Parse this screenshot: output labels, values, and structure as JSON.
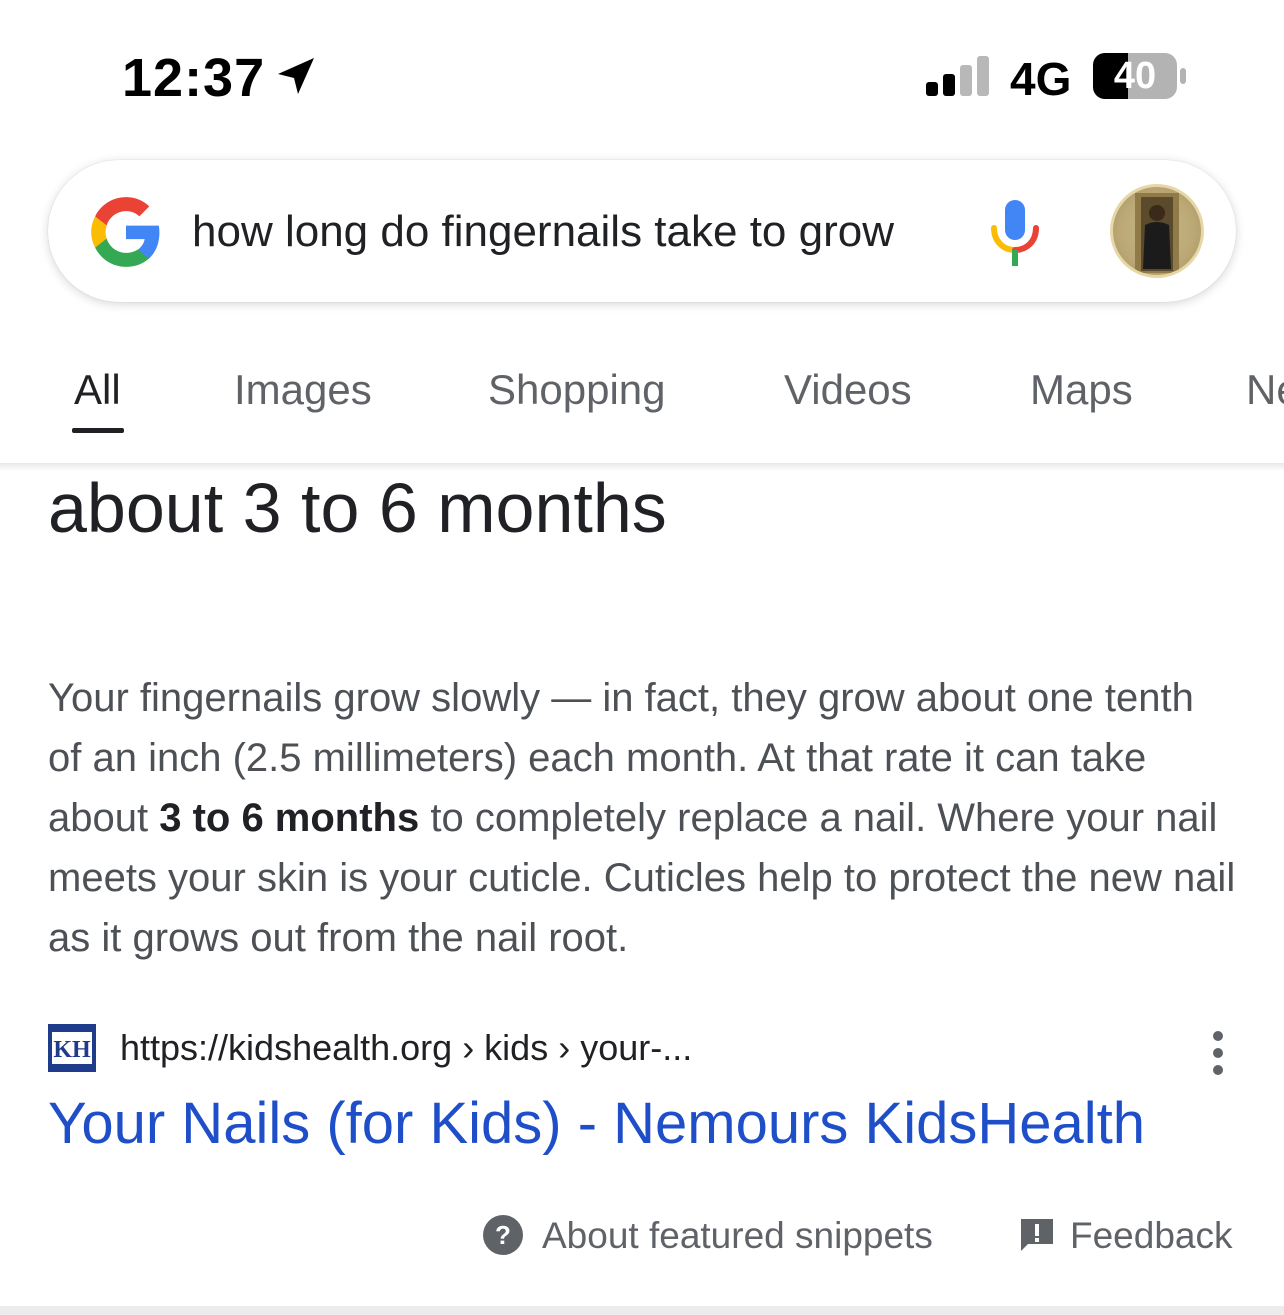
{
  "status_bar": {
    "time": "12:37",
    "network": "4G",
    "battery": "40",
    "icons": [
      "location-arrow-icon",
      "cellular-signal-icon",
      "battery-icon"
    ]
  },
  "search": {
    "query": "how long do fingernails take to grow",
    "icons": [
      "google-g-logo-icon",
      "microphone-icon",
      "profile-avatar"
    ]
  },
  "tabs": [
    {
      "label": "All",
      "active": true
    },
    {
      "label": "Images"
    },
    {
      "label": "Shopping"
    },
    {
      "label": "Videos"
    },
    {
      "label": "Maps"
    },
    {
      "label": "Ne"
    }
  ],
  "featured_snippet": {
    "answer": "about 3 to 6 months",
    "text_before": "Your fingernails grow slowly — in fact, they grow about one tenth of an inch (2.5 millimeters) each month. At that rate it can take about ",
    "text_bold": "3 to 6 months",
    "text_after": " to completely replace a nail. Where your nail meets your skin is your cuticle. Cuticles help to protect the new nail as it grows out from the nail root.",
    "source": {
      "favicon_text": "KH",
      "url": "https://kidshealth.org › kids › your-...",
      "title": "Your Nails (for Kids) - Nemours KidsHealth"
    }
  },
  "footer": {
    "about_label": "About featured snippets",
    "feedback_label": "Feedback"
  },
  "colors": {
    "link_blue": "#1f4ec9",
    "text_dark": "#202124",
    "text_gray": "#5f6368",
    "google_blue": "#4285F4",
    "google_red": "#EA4335",
    "google_yellow": "#FBBC05",
    "google_green": "#34A853"
  }
}
